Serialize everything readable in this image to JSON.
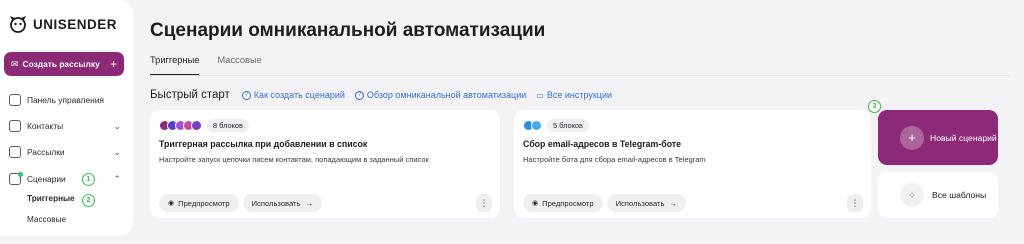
{
  "app": {
    "logo_text": "UNISENDER"
  },
  "sidebar": {
    "create_label": "Создать рассылку",
    "items": [
      {
        "label": "Панель управления",
        "icon": "home-icon"
      },
      {
        "label": "Контакты",
        "icon": "contacts-icon"
      },
      {
        "label": "Рассылки",
        "icon": "mail-icon"
      },
      {
        "label": "Сценарии",
        "icon": "scenario-icon"
      }
    ],
    "sub_items": [
      {
        "label": "Триггерные"
      },
      {
        "label": "Массовые"
      }
    ],
    "badges": [
      "1",
      "2"
    ]
  },
  "main": {
    "title": "Сценарии омниканальной автоматизации",
    "tabs": [
      {
        "label": "Триггерные"
      },
      {
        "label": "Массовые"
      }
    ],
    "quick_start": {
      "title": "Быстрый старт",
      "links": [
        {
          "label": "Как создать сценарий"
        },
        {
          "label": "Обзор омниканальной автоматизации"
        },
        {
          "label": "Все инструкции"
        }
      ]
    },
    "cards": [
      {
        "blocks": "8 блоков",
        "title": "Триггерная рассылка при добавлении в список",
        "desc": "Настройте запуск цепочки писем контактам, попадающим в заданный список",
        "preview": "Предпросмотр",
        "use": "Использовать",
        "kebab": "⋮"
      },
      {
        "blocks": "5 блоков",
        "title": "Сбор email-адресов в Telegram-боте",
        "desc": "Настройте бота для сбора email-адресов в Telegram",
        "preview": "Предпросмотр",
        "use": "Использовать",
        "kebab": "⋮"
      }
    ],
    "new_scenario": "Новый сценарий",
    "all_templates": "Все шаблоны",
    "badge_3": "3"
  },
  "colors": {
    "brand": "#8d2a77",
    "link": "#3a6fd8",
    "badge": "#3dbb4a"
  }
}
